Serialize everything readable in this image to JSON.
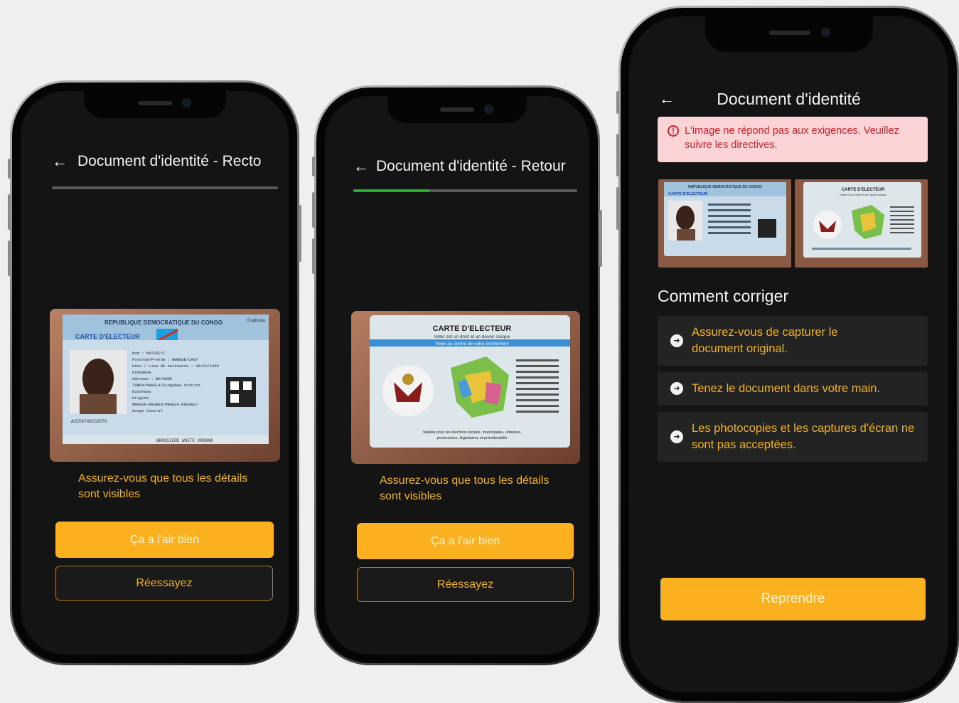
{
  "phone1": {
    "title": "Document d'identité - Recto",
    "progress": 0,
    "card": {
      "header_line1": "REPUBLIQUE DEMOCRATIQUE DU CONGO",
      "header_line2": "CARTE D'ELECTEUR",
      "tag": "Duplicata",
      "fields": [
        "Nom : MATUZEYI",
        "Postnom/Prenom : BWENDE/LADY",
        "Date / Lieu de naissance : 08/12/1985",
        "KINSHASA",
        "Adresse : BAYONNE",
        "TAMPA/MAKALA/Kingabwa Voiture",
        "Kinshasa",
        "Origine",
        "MBANZA-NGUNGU/MBANZA-NGUNGU/",
        "Kongo Central"
      ],
      "number": "A3556748233576",
      "footer": "BRASSIERE WHITE VRDANA"
    },
    "hint": "Assurez-vous que tous les détails sont visibles",
    "primary_button": "Ça a l'air bien",
    "secondary_button": "Réessayez"
  },
  "phone2": {
    "title": "Document d'identité - Retour",
    "progress": 0.34,
    "card": {
      "title": "CARTE D'ELECTEUR",
      "subtitle": "Voter est un droit et un devoir civique",
      "banner": "Voter au centre de votre enrôlement",
      "footer": "Valable pour les élections locales, municipales, urbaines, provinciales, législatives et présidentielle"
    },
    "hint": "Assurez-vous que tous les détails sont visibles",
    "primary_button": "Ça a l'air bien",
    "secondary_button": "Réessayez"
  },
  "phone3": {
    "title": "Document d'identité",
    "error": "L'image ne répond pas aux exigences. Veuillez suivre les directives.",
    "thumb_front": {
      "header": "REPUBLIQUE DEMOCRATIQUE DU CONGO",
      "label": "CARTE D'ELECTEUR"
    },
    "thumb_back": {
      "label": "CARTE D'ELECTEUR",
      "subtitle": "Voter est un droit et un devoir civique"
    },
    "section_title": "Comment corriger",
    "tips": [
      {
        "text": "Assurez-vous de capturer le document original."
      },
      {
        "text": "Tenez le document dans votre main."
      },
      {
        "text": "Les photocopies et les captures d'écran ne sont pas acceptées."
      }
    ],
    "primary_button": "Reprendre"
  },
  "colors": {
    "accent": "#fbb01f",
    "hint_text": "#f0b21e",
    "progress_fill": "#20b030",
    "error_bg": "#fcd4d5",
    "error_text": "#d0212b",
    "screen_bg": "#141414"
  },
  "icons": {
    "back": "arrow-left-icon",
    "error": "alert-circle-icon",
    "tip": "arrow-right-circle-icon"
  }
}
